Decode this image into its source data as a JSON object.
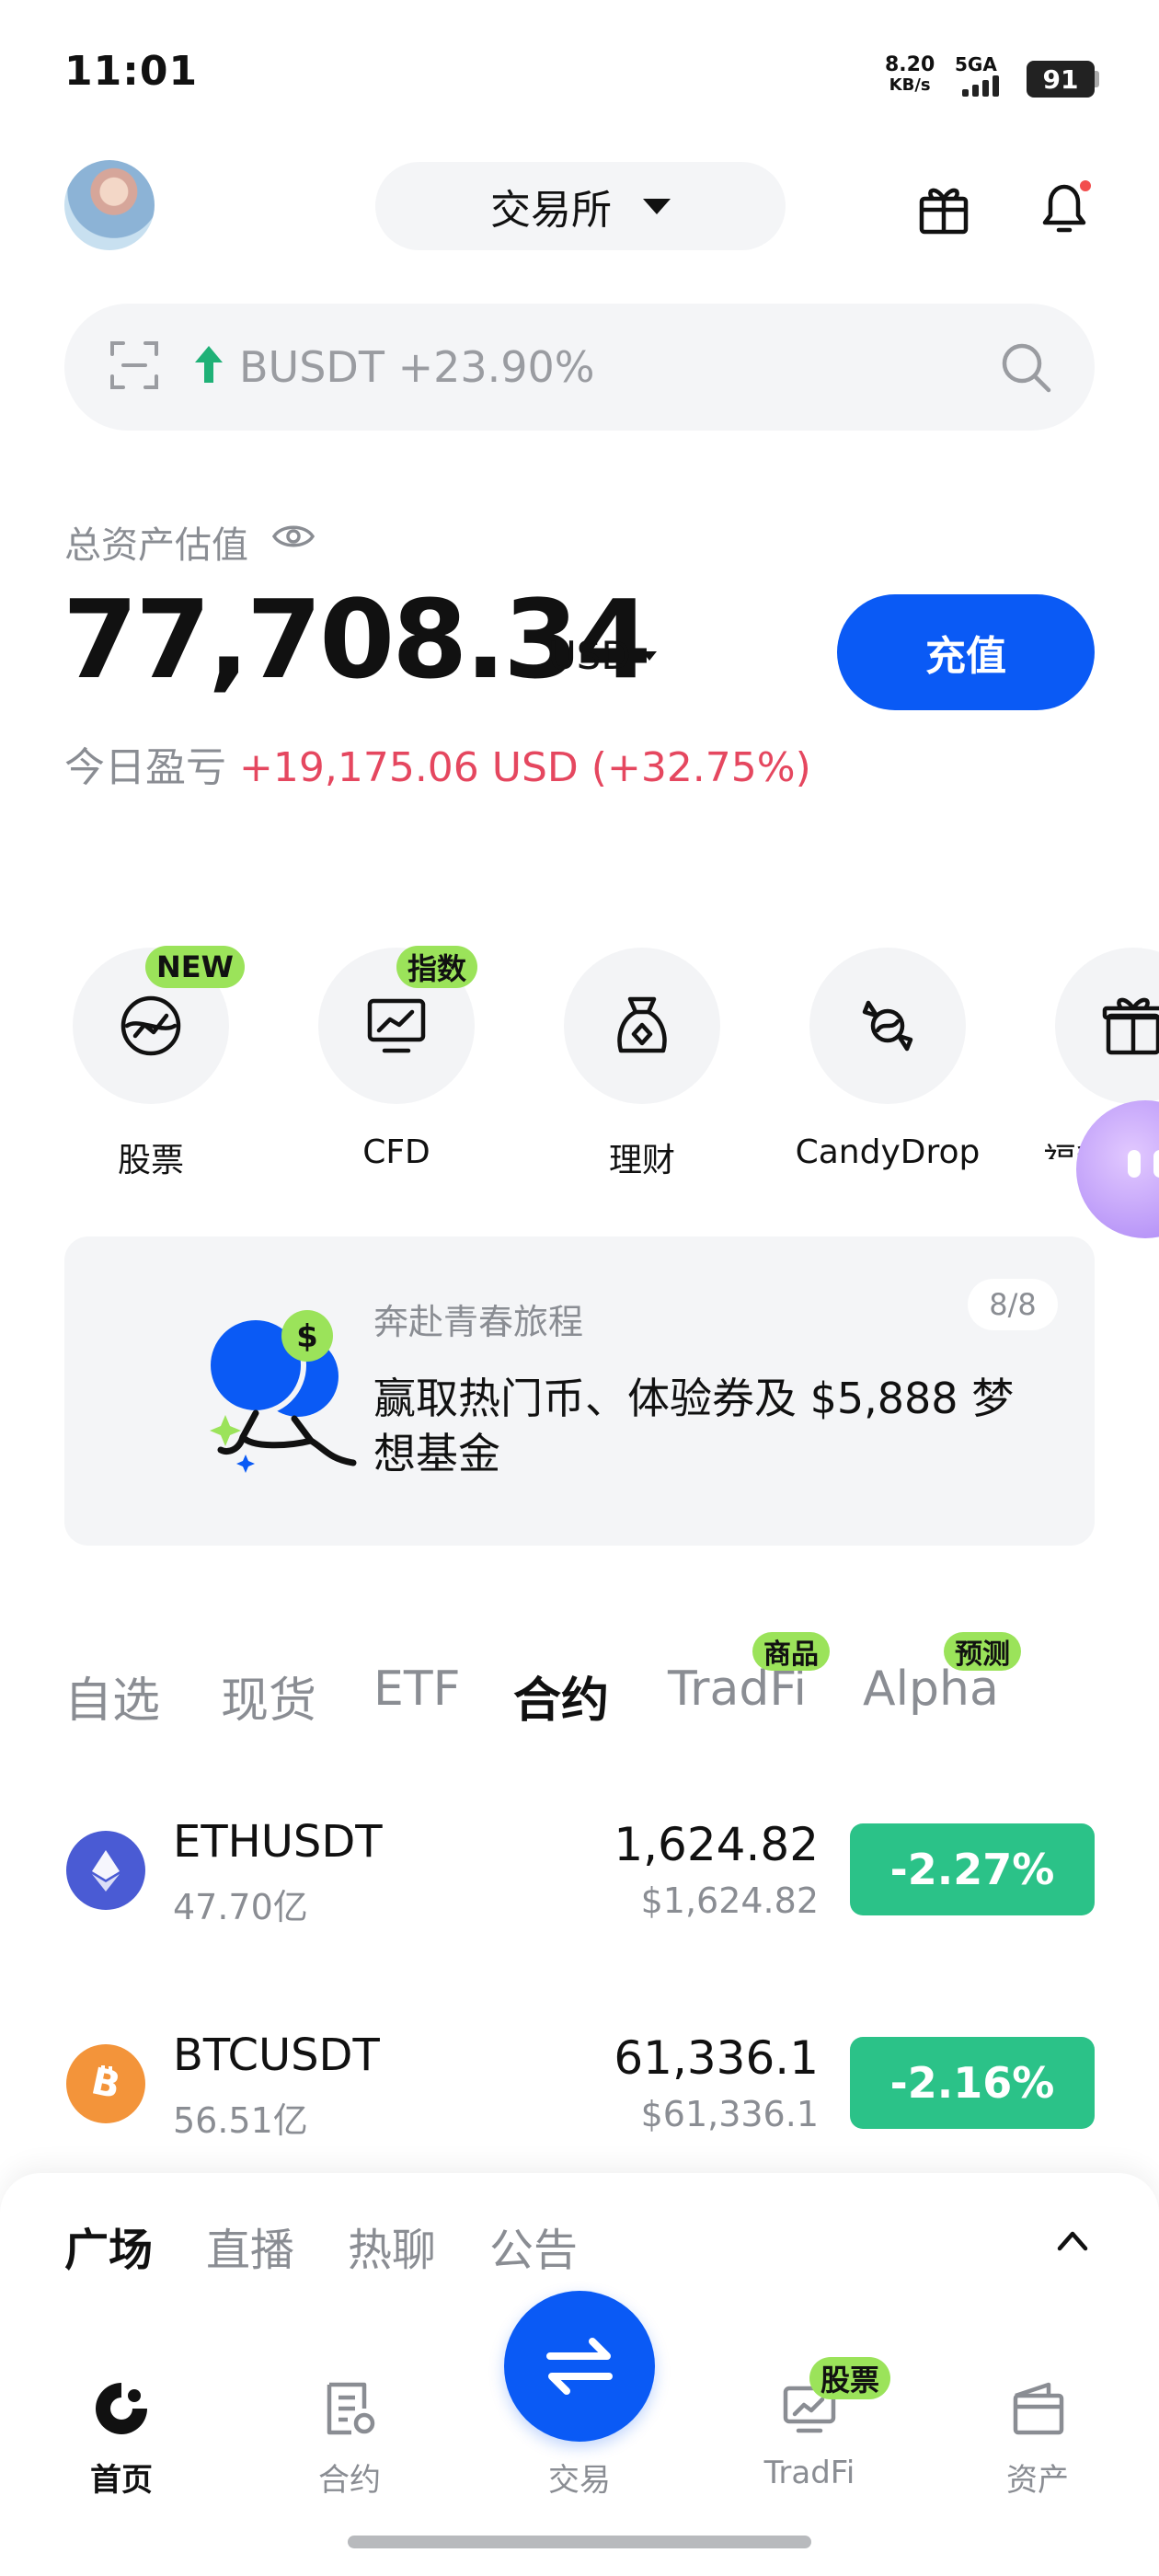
{
  "status_bar": {
    "time": "11:01",
    "net_speed": "8.20",
    "net_unit": "KB/s",
    "network": "5GA",
    "battery": "91"
  },
  "header": {
    "mode_label": "交易所"
  },
  "search": {
    "trend_text": "BUSDT +23.90%"
  },
  "assets": {
    "label": "总资产估值",
    "total": "77,708.34",
    "currency": "USD",
    "deposit_label": "充值",
    "pnl_label": "今日盈亏",
    "pnl_value": "+19,175.06 USD (+32.75%)"
  },
  "shortcuts": [
    {
      "label": "股票",
      "badge": "NEW",
      "icon": "globe-chart-icon"
    },
    {
      "label": "CFD",
      "badge": "指数",
      "icon": "monitor-chart-icon"
    },
    {
      "label": "理财",
      "badge": "",
      "icon": "money-bag-icon"
    },
    {
      "label": "CandyDrop",
      "badge": "",
      "icon": "candy-icon"
    },
    {
      "label": "福利中",
      "badge": "",
      "icon": "gift-icon"
    }
  ],
  "promo": {
    "subtitle": "奔赴青春旅程",
    "title": "赢取热门币、体验券及 $5,888 梦想基金",
    "count": "8/8"
  },
  "market_tabs": [
    {
      "label": "自选",
      "badge": ""
    },
    {
      "label": "现货",
      "badge": ""
    },
    {
      "label": "ETF",
      "badge": ""
    },
    {
      "label": "合约",
      "badge": "",
      "active": true
    },
    {
      "label": "TradFi",
      "badge": "商品"
    },
    {
      "label": "Alpha",
      "badge": "预测"
    }
  ],
  "markets": [
    {
      "symbol": "ETHUSDT",
      "volume": "47.70亿",
      "price": "1,624.82",
      "fiat": "$1,624.82",
      "change": "-2.27%",
      "logo_color": "#4a5bd4"
    },
    {
      "symbol": "BTCUSDT",
      "volume": "56.51亿",
      "price": "61,336.1",
      "fiat": "$61,336.1",
      "change": "-2.16%",
      "logo_color": "#f3943a"
    }
  ],
  "sheet_tabs": [
    "广场",
    "直播",
    "热聊",
    "公告"
  ],
  "bottom_nav": [
    {
      "label": "首页",
      "icon": "home-icon",
      "active": true
    },
    {
      "label": "合约",
      "icon": "contract-icon"
    },
    {
      "label": "交易",
      "icon": "swap-icon"
    },
    {
      "label": "TradFi",
      "icon": "tradfi-icon",
      "badge": "股票"
    },
    {
      "label": "资产",
      "icon": "wallet-icon"
    }
  ],
  "colors": {
    "accent": "#0a5af5",
    "up_green": "#2bc288",
    "loss_red": "#e5475f",
    "badge_green": "#9be35a"
  }
}
